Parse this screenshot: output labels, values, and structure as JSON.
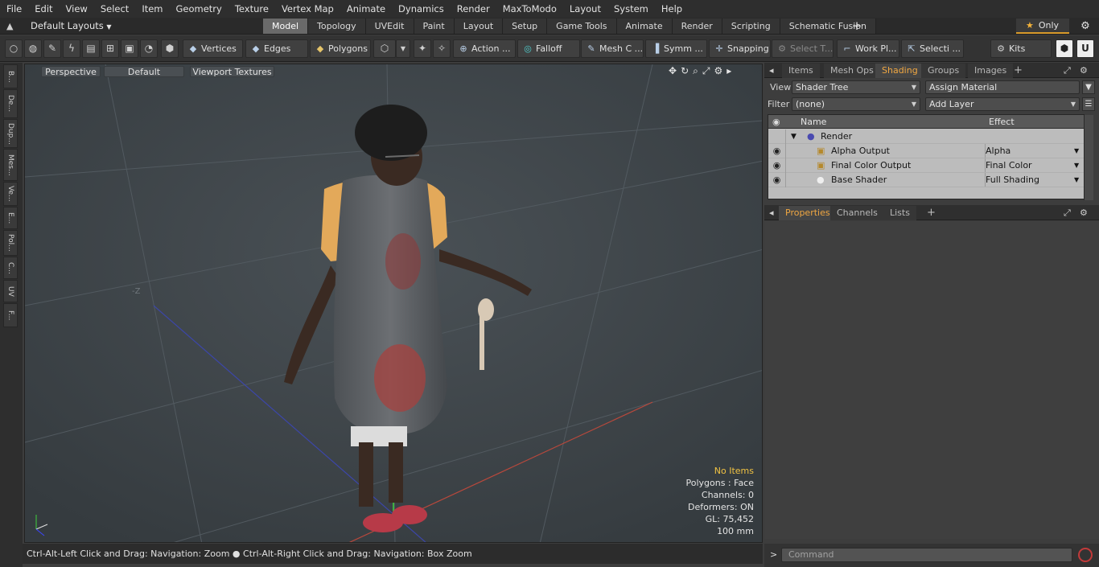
{
  "menubar": [
    "File",
    "Edit",
    "View",
    "Select",
    "Item",
    "Geometry",
    "Texture",
    "Vertex Map",
    "Animate",
    "Dynamics",
    "Render",
    "MaxToModo",
    "Layout",
    "System",
    "Help"
  ],
  "layouts": {
    "label": "Default Layouts"
  },
  "tabs": [
    "Model",
    "Topology",
    "UVEdit",
    "Paint",
    "Layout",
    "Setup",
    "Game Tools",
    "Animate",
    "Render",
    "Scripting",
    "Schematic Fusion"
  ],
  "active_tab": "Model",
  "only_label": "Only",
  "toolbar": {
    "vertices": "Vertices",
    "edges": "Edges",
    "polygons": "Polygons",
    "action": "Action",
    "falloff": "Falloff",
    "meshc": "Mesh C ...",
    "symm": "Symm ...",
    "snapping": "Snapping",
    "selectt": "Select T...",
    "workpl": "Work Pl...",
    "selecti": "Selecti ...",
    "kits": "Kits"
  },
  "left_tabs": [
    "B...",
    "De...",
    "Dup...",
    "Mes...",
    "Ve...",
    "E...",
    "Pol...",
    "C...",
    "UV",
    "F..."
  ],
  "viewport": {
    "perspective": "Perspective",
    "default": "Default",
    "textures": "Viewport Textures",
    "axis_label": "-Z",
    "stats": {
      "items": "No Items",
      "polygons": "Polygons : Face",
      "channels": "Channels: 0",
      "deformers": "Deformers: ON",
      "gl": "GL: 75,452",
      "scale": "100 mm"
    }
  },
  "statusbar": {
    "left": "Ctrl-Alt-Left Click and Drag: Navigation: Zoom",
    "right": "Ctrl-Alt-Right Click and Drag: Navigation: Box Zoom"
  },
  "upper_panel": {
    "tabs": [
      "Items",
      "Mesh Ops",
      "Shading",
      "Groups",
      "Images"
    ],
    "active": "Shading",
    "view_label": "View",
    "view_value": "Shader Tree",
    "assign": "Assign Material",
    "filter_label": "Filter",
    "filter_value": "(none)",
    "add_layer": "Add Layer",
    "col_name": "Name",
    "col_effect": "Effect",
    "rows": [
      {
        "name": "Render",
        "effect": ""
      },
      {
        "name": "Alpha Output",
        "effect": "Alpha"
      },
      {
        "name": "Final Color Output",
        "effect": "Final Color"
      },
      {
        "name": "Base Shader",
        "effect": "Full Shading"
      }
    ]
  },
  "lower_panel": {
    "tabs": [
      "Properties",
      "Channels",
      "Lists"
    ],
    "active": "Properties"
  },
  "command": {
    "placeholder": "Command"
  }
}
